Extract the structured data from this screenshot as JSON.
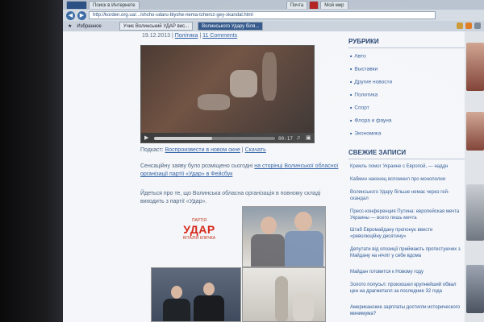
{
  "browser": {
    "top_tabs": [
      {
        "label": "Поиск в Интернете"
      },
      {
        "label": "Почта"
      },
      {
        "label": "Мой мир"
      }
    ],
    "url": "http://korden.org.ua/.../shcho-udaru-blyshe-nema-tchersz-gey-skandal.html",
    "bookmarks_label": "Избранное",
    "open_tabs": [
      {
        "label": "Учиє Волинський УДАР вис..."
      },
      {
        "label": "Волинського Удару біля..."
      }
    ]
  },
  "post": {
    "date": "19.12.2013",
    "category": "Політика",
    "comments": "11 Comments",
    "video": {
      "time": "00:17",
      "progress": 0.48
    },
    "podcast_prefix": "Подкаст:",
    "podcast_play": "Воспроизвести в новом окне",
    "podcast_download": "Скачать",
    "para1_text": "Сенсаційну заяву було розміщено сьогодні ",
    "para1_link": "на сторінці Волинської обласної організації партії «Удар» в Фейсбук",
    "para2_text": "Йдеться про те, що Волинська обласна організація в повному складі виходить з партії «Удар».",
    "logo_small": "ПАРТІЯ",
    "logo_big": "УДАР",
    "logo_sub": "ВІТАЛІЯ КЛИЧКА"
  },
  "sidebar": {
    "rubrics_title": "РУБРИКИ",
    "rubrics": [
      "Авто",
      "Выставки",
      "Другие новости",
      "Политика",
      "Спорт",
      "Флора и фауна",
      "Экономика"
    ],
    "recent_title": "СВЕЖИЕ ЗАПИСИ",
    "recent": [
      "Кремль помог Украине с Европой, — наддн",
      "Кабмин наконец вспомнил про монополии",
      "Волинського Удару більше немає через гей-скандал",
      "Пресс-конференция Путина: европейская мечта Украины — всего лишь мечта",
      "Штаб Евромайдану пропонує ввести «революційну десятину»",
      "Депутати від опозиції приймають протестуючих з Майдану на нічліг у себе вдома",
      "Майдан готовится к Новому году",
      "Золото попусьл: произошел крупнейший обвал цен на драгметалл за последние 32 года",
      "Американские зарплаты достигли исторического минимума?"
    ]
  }
}
